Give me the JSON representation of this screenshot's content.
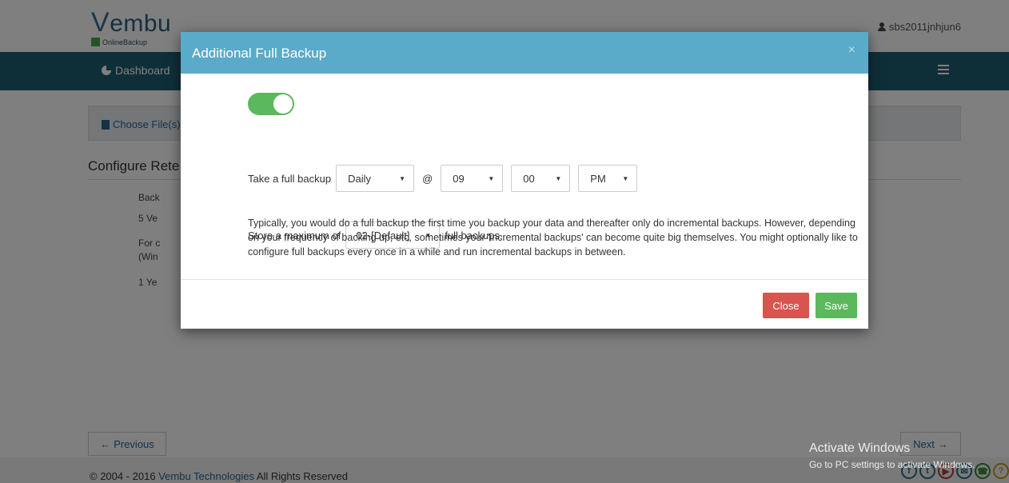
{
  "header": {
    "logo_word": "embu",
    "logo_v": "V",
    "logo_sub": "OnlineBackup",
    "username": "sbs2011jnhjun6"
  },
  "nav": {
    "dashboard_label": "Dashboard"
  },
  "page": {
    "choose_files_label": "Choose File(s)",
    "section_title": "Configure Rete",
    "bg_lines": [
      "Back",
      "5 Ve",
      "For c",
      "(Win",
      "1 Ye"
    ],
    "previous_label": "Previous",
    "next_label": "Next"
  },
  "footer": {
    "copyright_prefix": "© 2004 - 2016 ",
    "company_link": "Vembu Technologies",
    "copyright_suffix": " All Rights Reserved",
    "social": [
      "f",
      "t",
      "yt",
      "@",
      "ph",
      "?"
    ]
  },
  "watermark": {
    "title": "Activate Windows",
    "subtitle": "Go to PC settings to activate Windows."
  },
  "modal": {
    "title": "Additional Full Backup",
    "close_x": "×",
    "toggle_on": true,
    "schedule_label": "Take a full backup",
    "frequency": "Daily",
    "at_symbol": "@",
    "hour": "09",
    "minute": "00",
    "ampm": "PM",
    "store_prefix": "Store a maximum of",
    "max_backups": "02-[Default]",
    "store_suffix": "full backups.",
    "description": "Typically, you would do a full backup the first time you backup your data and thereafter only do incremental backups. However, depending on your frequency of backing up, etc, sometimes your 'incremental backups' can become quite big themselves. You might optionally like to configure full backups every once in a while and run incremental backups in between.",
    "close_button": "Close",
    "save_button": "Save"
  },
  "colors": {
    "modal_header": "#5aaac9",
    "navbar": "#1e5f70",
    "toggle_on": "#5cb85c",
    "close_button": "#d9534f",
    "save_button": "#5cb85c"
  }
}
